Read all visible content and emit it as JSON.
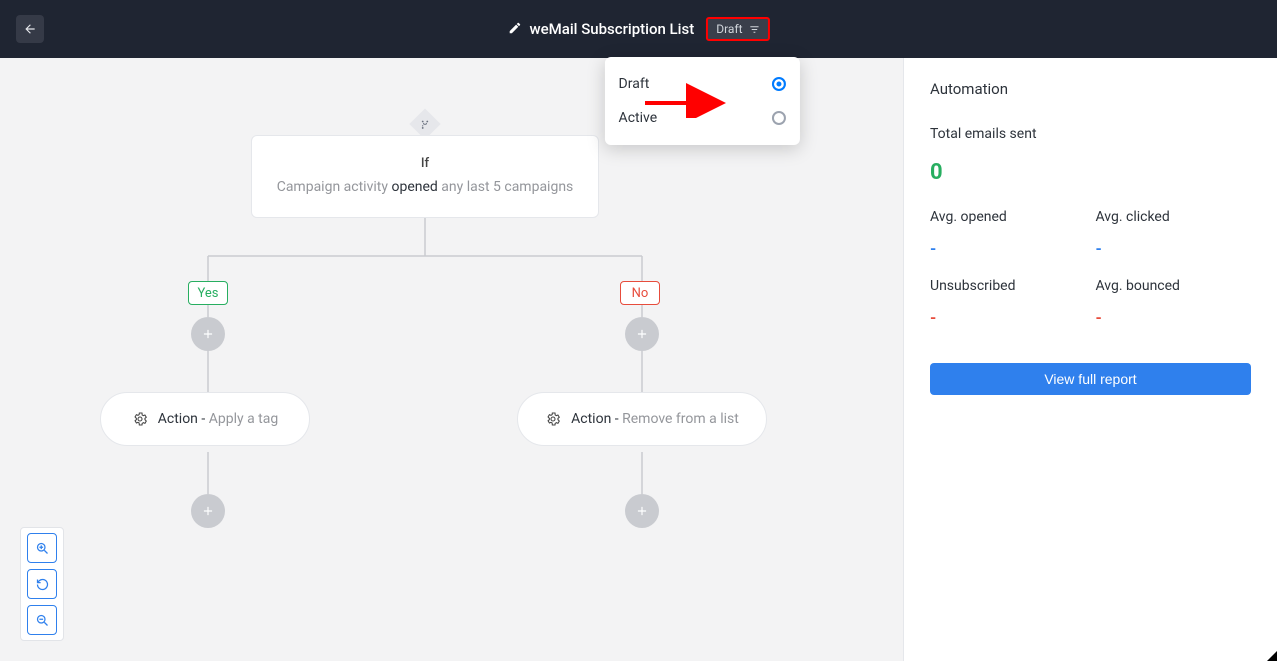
{
  "header": {
    "title": "weMail Subscription List",
    "status_chip": "Draft",
    "options": {
      "draft": "Draft",
      "active": "Active"
    },
    "selected": "draft"
  },
  "flow": {
    "if_title": "If",
    "if_prefix": "Campaign activity",
    "if_keyword": "opened",
    "if_suffix": "any last 5 campaigns",
    "yes_label": "Yes",
    "no_label": "No",
    "action_word": "Action - ",
    "yes_action": "Apply a tag",
    "no_action": "Remove from a list"
  },
  "sidebar": {
    "title": "Automation",
    "total_label": "Total emails sent",
    "total_value": "0",
    "metrics": {
      "avg_opened": {
        "label": "Avg. opened",
        "value": "-",
        "cls": "blue-dash"
      },
      "avg_clicked": {
        "label": "Avg. clicked",
        "value": "-",
        "cls": "blue-dash"
      },
      "unsubscribed": {
        "label": "Unsubscribed",
        "value": "-",
        "cls": "red-dash"
      },
      "avg_bounced": {
        "label": "Avg. bounced",
        "value": "-",
        "cls": "red-dash"
      }
    },
    "report_button": "View full report"
  },
  "icons": {
    "back": "back-icon",
    "pencil": "pencil-icon",
    "filter": "filter-icon",
    "gear": "gear-icon",
    "branch": "branch-icon",
    "zoom_in": "zoom-in-icon",
    "zoom_reset": "zoom-reset-icon",
    "zoom_out": "zoom-out-icon"
  }
}
